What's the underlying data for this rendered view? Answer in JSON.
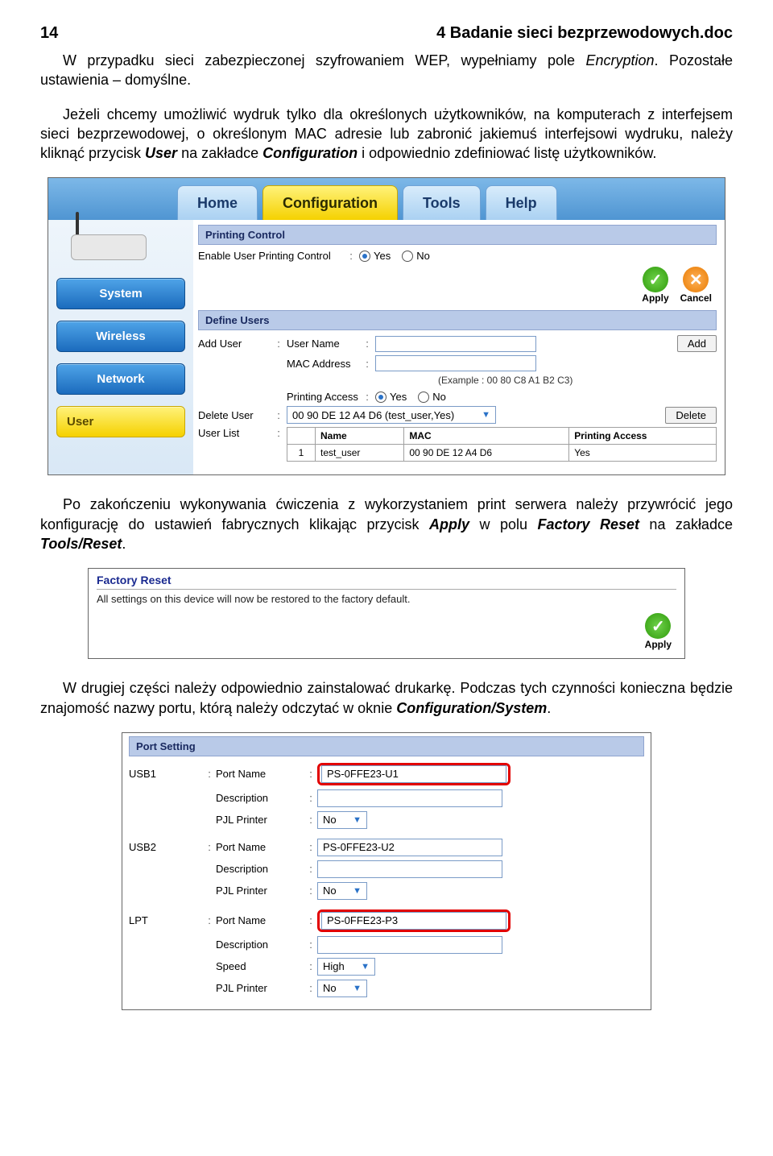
{
  "header": {
    "page_number": "14",
    "title": "4 Badanie sieci bezprzewodowych.doc"
  },
  "paragraphs": {
    "p1_a": "W przypadku sieci zabezpieczonej szyfrowaniem WEP, wypełniamy pole ",
    "p1_em": "Encryption",
    "p1_b": ". Pozostałe ustawienia – domyślne.",
    "p2_a": "Jeżeli chcemy umożliwić wydruk tylko dla określonych użytkowników, na komputerach z interfejsem sieci bezprzewodowej, o określonym MAC adresie lub zabronić jakiemuś interfejsowi wydruku, należy kliknąć przycisk ",
    "p2_b1": "User",
    "p2_b": " na zakładce ",
    "p2_b2": "Configuration",
    "p2_c": " i odpowiednio zdefiniować listę użytkowników.",
    "p3_a": "Po zakończeniu wykonywania ćwiczenia z wykorzystaniem print serwera należy przywrócić jego konfigurację do ustawień fabrycznych klikając przycisk ",
    "p3_b1": "Apply",
    "p3_b": " w polu ",
    "p3_b2": "Factory Reset",
    "p3_c": " na zakładce ",
    "p3_b3": "Tools/Reset",
    "p3_d": ".",
    "p4_a": "W drugiej części należy odpowiednio zainstalować drukarkę. Podczas tych czynności konieczna będzie znajomość nazwy portu, którą należy odczytać w oknie ",
    "p4_b1": "Configuration/System",
    "p4_b": "."
  },
  "shot1": {
    "tabs": {
      "home": "Home",
      "config": "Configuration",
      "tools": "Tools",
      "help": "Help"
    },
    "nav": {
      "system": "System",
      "wireless": "Wireless",
      "network": "Network",
      "user": "User"
    },
    "printing_control": {
      "title": "Printing Control",
      "enable_label": "Enable User Printing Control",
      "yes": "Yes",
      "no": "No",
      "apply": "Apply",
      "cancel": "Cancel"
    },
    "define_users": {
      "title": "Define Users",
      "add_user": "Add User",
      "user_name": "User Name",
      "mac_address": "MAC Address",
      "example": "(Example : 00 80 C8 A1 B2 C3)",
      "printing_access": "Printing Access",
      "yes": "Yes",
      "no": "No",
      "delete_user": "Delete User",
      "delete_value": "00 90 DE 12 A4 D6 (test_user,Yes)",
      "user_list": "User List",
      "btn_add": "Add",
      "btn_delete": "Delete",
      "table": {
        "col_idx": "1",
        "col_name_h": "Name",
        "col_mac_h": "MAC",
        "col_pa_h": "Printing Access",
        "row1_name": "test_user",
        "row1_mac": "00 90 DE 12 A4 D6",
        "row1_pa": "Yes"
      }
    }
  },
  "shot2": {
    "title": "Factory Reset",
    "text": "All settings on this device will now be restored to the factory default.",
    "apply": "Apply"
  },
  "shot3": {
    "title": "Port Setting",
    "labels": {
      "usb1": "USB1",
      "usb2": "USB2",
      "lpt": "LPT",
      "port_name": "Port Name",
      "description": "Description",
      "pjl_printer": "PJL Printer",
      "speed": "Speed"
    },
    "values": {
      "usb1_port": "PS-0FFE23-U1",
      "usb2_port": "PS-0FFE23-U2",
      "lpt_port": "PS-0FFE23-P3",
      "no": "No",
      "high": "High"
    }
  }
}
